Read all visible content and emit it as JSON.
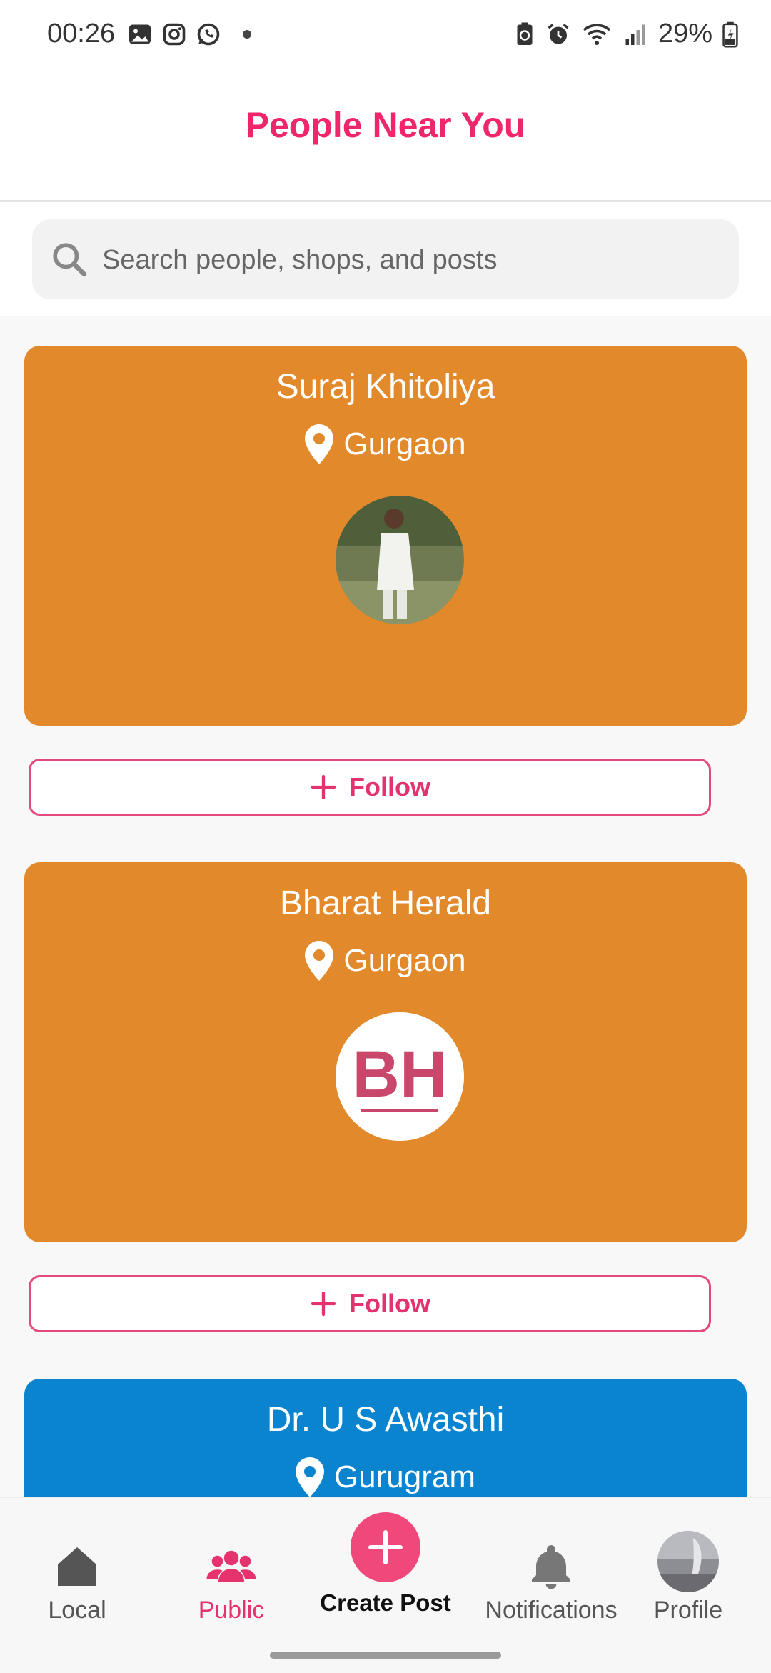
{
  "status_bar": {
    "time": "00:26",
    "battery": "29%",
    "left_icons": [
      "gallery-icon",
      "instagram-icon",
      "whatsapp-icon",
      "dot-icon"
    ],
    "right_icons": [
      "battery-saver-icon",
      "alarm-icon",
      "wifi-icon",
      "signal-icon",
      "battery-icon"
    ]
  },
  "header": {
    "title": "People Near You"
  },
  "search": {
    "placeholder": "Search people, shops, and posts"
  },
  "colors": {
    "accent": "#f0266b",
    "card_orange": "#e28a2b",
    "card_blue": "#0a84cf"
  },
  "people": [
    {
      "name": "Suraj Khitoliya",
      "location": "Gurgaon",
      "follow_label": "Follow",
      "card_color": "#e28a2b",
      "avatar": "person-photo"
    },
    {
      "name": "Bharat Herald",
      "location": "Gurgaon",
      "follow_label": "Follow",
      "card_color": "#e28a2b",
      "avatar": "bh-logo",
      "avatar_text": "BH"
    },
    {
      "name": "Dr. U S Awasthi",
      "location": "Gurugram",
      "card_color": "#0a84cf"
    }
  ],
  "nav": {
    "local": "Local",
    "public": "Public",
    "create": "Create Post",
    "notifications": "Notifications",
    "profile": "Profile"
  }
}
